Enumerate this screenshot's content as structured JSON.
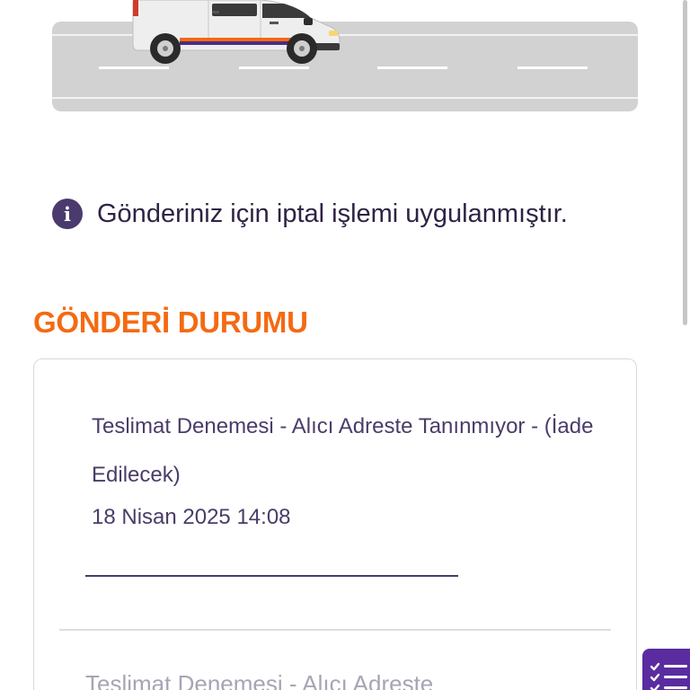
{
  "notice": {
    "icon": "info-icon",
    "text": "Gönderiniz için iptal işlemi uygulanmıştır."
  },
  "shipment_status": {
    "title": "GÖNDERİ DURUMU",
    "events": [
      {
        "title": "Teslimat Denemesi - Alıcı Adreste Tanınmıyor - (İade Edilecek)",
        "date": "18 Nisan 2025 14:08"
      },
      {
        "title": "Teslimat Denemesi - Alıcı Adreste"
      }
    ]
  },
  "fab": {
    "icon": "checklist-icon",
    "color": "#5a2ca0"
  },
  "colors": {
    "accent_orange": "#f46a12",
    "brand_purple": "#4a3a6e",
    "road_gray": "#d2d2d2"
  }
}
